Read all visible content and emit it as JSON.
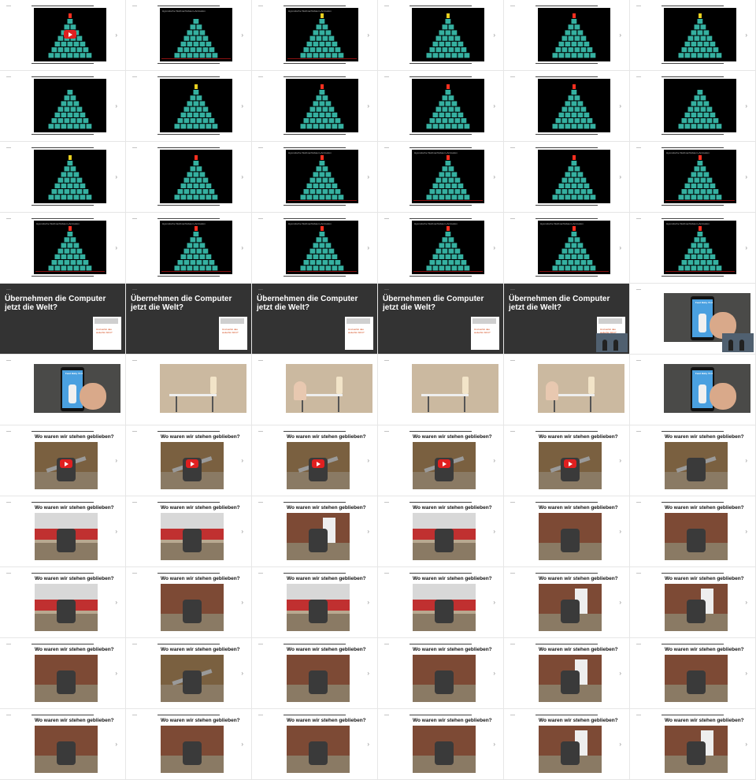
{
  "row_a_video_title": "Hypnotische Weihnachtsbaum-Animation",
  "dark_slide_title": "Übernehmen die Computer jetzt die Welt?",
  "dark_slide_note": "Und wohin das weiterhin führt?",
  "robot_slide_title": "Wo waren wir stehen geblieben?",
  "baby_app_label": "Feed Baby V1.0",
  "colors": {
    "dark_slide_bg": "#333333",
    "video_bg": "#000000",
    "play_button": "#e02020",
    "tree_cube": "#35b0a0",
    "star": "#ff3020",
    "note_text": "#d04010"
  },
  "cells": [
    {
      "type": "tree",
      "play": true,
      "star": "red",
      "title": false
    },
    {
      "type": "tree",
      "play": false,
      "star": "none",
      "title": true
    },
    {
      "type": "tree",
      "play": false,
      "star": "yellow",
      "title": true
    },
    {
      "type": "tree",
      "play": false,
      "star": "yellow",
      "title": false
    },
    {
      "type": "tree",
      "play": false,
      "star": "red",
      "title": false
    },
    {
      "type": "tree",
      "play": false,
      "star": "yellow",
      "title": false
    },
    {
      "type": "tree",
      "play": false,
      "star": "none",
      "title": false
    },
    {
      "type": "tree",
      "play": false,
      "star": "yellow",
      "title": false
    },
    {
      "type": "tree",
      "play": false,
      "star": "red",
      "title": false
    },
    {
      "type": "tree",
      "play": false,
      "star": "red",
      "title": false
    },
    {
      "type": "tree",
      "play": false,
      "star": "red",
      "title": false
    },
    {
      "type": "tree",
      "play": false,
      "star": "none",
      "title": false
    },
    {
      "type": "tree",
      "play": false,
      "star": "yellow",
      "title": false
    },
    {
      "type": "tree",
      "play": false,
      "star": "red",
      "title": false
    },
    {
      "type": "tree",
      "play": false,
      "star": "red",
      "title": true
    },
    {
      "type": "tree",
      "play": false,
      "star": "red",
      "title": true
    },
    {
      "type": "tree",
      "play": false,
      "star": "red",
      "title": false
    },
    {
      "type": "tree",
      "play": false,
      "star": "red",
      "title": true
    },
    {
      "type": "tree",
      "play": false,
      "star": "red",
      "title": true
    },
    {
      "type": "tree",
      "play": false,
      "star": "red",
      "title": true
    },
    {
      "type": "tree",
      "play": false,
      "star": "red",
      "title": true
    },
    {
      "type": "tree",
      "play": false,
      "star": "red",
      "title": true
    },
    {
      "type": "tree",
      "play": false,
      "star": "red",
      "title": true
    },
    {
      "type": "tree",
      "play": false,
      "star": "red",
      "title": true
    },
    {
      "type": "dark",
      "pip": false
    },
    {
      "type": "dark",
      "pip": false
    },
    {
      "type": "dark",
      "pip": false
    },
    {
      "type": "dark",
      "pip": false
    },
    {
      "type": "dark",
      "pip": true
    },
    {
      "type": "phone",
      "pip": true
    },
    {
      "type": "phone",
      "pip": false
    },
    {
      "type": "kitchen",
      "pip": false
    },
    {
      "type": "kitchen",
      "pip": false
    },
    {
      "type": "kitchen",
      "pip": false
    },
    {
      "type": "kitchen",
      "pip": false
    },
    {
      "type": "phone",
      "pip": false
    },
    {
      "type": "robot",
      "scene": "wreck",
      "play": true
    },
    {
      "type": "robot",
      "scene": "wreck",
      "play": true
    },
    {
      "type": "robot",
      "scene": "wreck",
      "play": true
    },
    {
      "type": "robot",
      "scene": "wreck",
      "play": true
    },
    {
      "type": "robot",
      "scene": "wreck",
      "play": true
    },
    {
      "type": "robot",
      "scene": "wreck",
      "play": false
    },
    {
      "type": "robot",
      "scene": "fence",
      "play": false
    },
    {
      "type": "robot",
      "scene": "fence",
      "play": false
    },
    {
      "type": "robot",
      "scene": "door",
      "play": false
    },
    {
      "type": "robot",
      "scene": "fence",
      "play": false
    },
    {
      "type": "robot",
      "scene": "wall",
      "play": false
    },
    {
      "type": "robot",
      "scene": "wall",
      "play": false
    },
    {
      "type": "robot",
      "scene": "fence",
      "play": false
    },
    {
      "type": "robot",
      "scene": "wall",
      "play": false
    },
    {
      "type": "robot",
      "scene": "fence",
      "play": false
    },
    {
      "type": "robot",
      "scene": "fence",
      "play": false
    },
    {
      "type": "robot",
      "scene": "door",
      "play": false
    },
    {
      "type": "robot",
      "scene": "door",
      "play": false
    },
    {
      "type": "robot",
      "scene": "wall",
      "play": false
    },
    {
      "type": "robot",
      "scene": "wreck",
      "play": false
    },
    {
      "type": "robot",
      "scene": "wall",
      "play": false
    },
    {
      "type": "robot",
      "scene": "wall",
      "play": false
    },
    {
      "type": "robot",
      "scene": "door",
      "play": false
    },
    {
      "type": "robot",
      "scene": "wall",
      "play": false
    },
    {
      "type": "robot",
      "scene": "wall",
      "play": false
    },
    {
      "type": "robot",
      "scene": "wall",
      "play": false
    },
    {
      "type": "robot",
      "scene": "wall",
      "play": false
    },
    {
      "type": "robot",
      "scene": "wall",
      "play": false
    },
    {
      "type": "robot",
      "scene": "door",
      "play": false
    },
    {
      "type": "robot",
      "scene": "door",
      "play": false
    }
  ]
}
